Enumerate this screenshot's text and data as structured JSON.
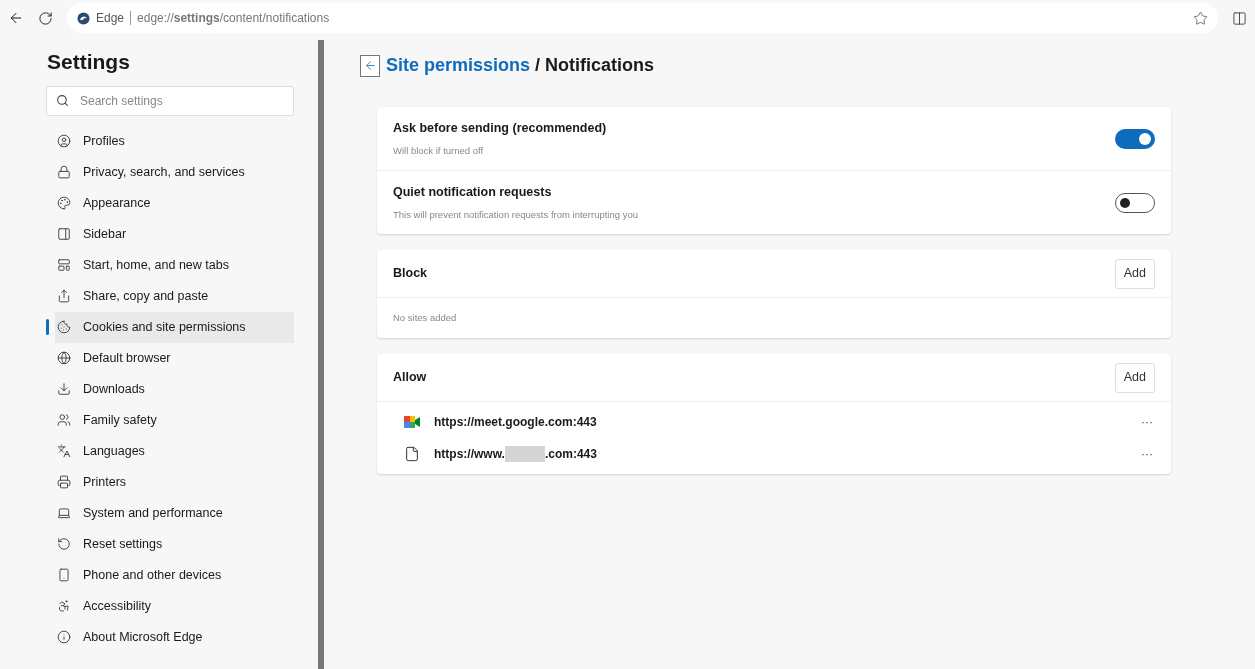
{
  "browser": {
    "site_label": "Edge",
    "address": "edge://**settings**/content/notifications"
  },
  "sidebar": {
    "title": "Settings",
    "search": {
      "placeholder": "Search settings"
    },
    "items": [
      {
        "label": "Profiles",
        "selected": false
      },
      {
        "label": "Privacy, search, and services",
        "selected": false
      },
      {
        "label": "Appearance",
        "selected": false
      },
      {
        "label": "Sidebar",
        "selected": false
      },
      {
        "label": "Start, home, and new tabs",
        "selected": false
      },
      {
        "label": "Share, copy and paste",
        "selected": false
      },
      {
        "label": "Cookies and site permissions",
        "selected": true
      },
      {
        "label": "Default browser",
        "selected": false
      },
      {
        "label": "Downloads",
        "selected": false
      },
      {
        "label": "Family safety",
        "selected": false
      },
      {
        "label": "Languages",
        "selected": false
      },
      {
        "label": "Printers",
        "selected": false
      },
      {
        "label": "System and performance",
        "selected": false
      },
      {
        "label": "Reset settings",
        "selected": false
      },
      {
        "label": "Phone and other devices",
        "selected": false
      },
      {
        "label": "Accessibility",
        "selected": false
      },
      {
        "label": "About Microsoft Edge",
        "selected": false
      }
    ]
  },
  "breadcrumb": {
    "parent": "Site permissions",
    "separator": "/",
    "current": "Notifications"
  },
  "toggles": [
    {
      "title": "Ask before sending (recommended)",
      "description": "Will block if turned off",
      "on": true
    },
    {
      "title": "Quiet notification requests",
      "description": "This will prevent notification requests from interrupting you",
      "on": false
    }
  ],
  "lists": [
    {
      "title": "Block",
      "button": "Add",
      "empty_text": "No sites added"
    },
    {
      "title": "Allow",
      "button": "Add",
      "sites": [
        {
          "kind": "meet",
          "url_start": "https://meet.google.com:443",
          "redacted": false,
          "more": "···"
        },
        {
          "kind": "page",
          "url_start": "https://www.",
          "redacted": true,
          "url_end": ".com:443",
          "more": "···"
        }
      ]
    }
  ]
}
